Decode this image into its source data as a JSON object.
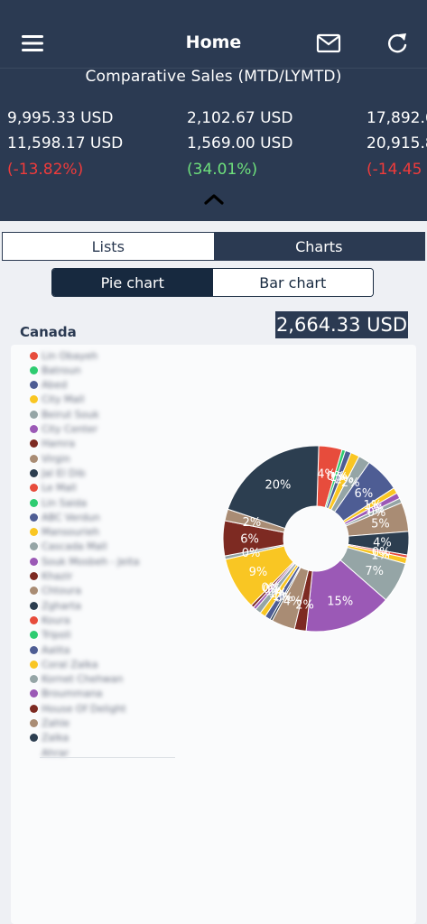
{
  "header": {
    "title": "Home",
    "subtitle": "Comparative Sales (MTD/LYMTD)"
  },
  "metrics": [
    {
      "mtd": "9,995.33 USD",
      "lymtd": "11,598.17 USD",
      "change": "(-13.82%)",
      "trend": "negative"
    },
    {
      "mtd": "2,102.67 USD",
      "lymtd": "1,569.00 USD",
      "change": "(34.01%)",
      "trend": "positive"
    },
    {
      "mtd": "17,892.6",
      "lymtd": "20,915.8",
      "change": "(-14.45",
      "trend": "negative"
    }
  ],
  "tabs": {
    "lists": "Lists",
    "charts": "Charts",
    "active": "lists"
  },
  "chart_toggle": {
    "pie": "Pie chart",
    "bar": "Bar chart",
    "active": "pie"
  },
  "region": "Canada",
  "total": "2,664.33 USD",
  "colors": {
    "header_bg": "#2b3a52",
    "negative": "#ef3b3b",
    "positive": "#6ee07c",
    "toggle_active": "#17293f"
  },
  "legend": [
    {
      "label": "Lin Obayeh",
      "color": "#e74c3c"
    },
    {
      "label": "Batroun",
      "color": "#2ecc71"
    },
    {
      "label": "Abed",
      "color": "#4e5d94"
    },
    {
      "label": "City Mall",
      "color": "#f9c623"
    },
    {
      "label": "Beirut Souk",
      "color": "#95a5a6"
    },
    {
      "label": "City Center",
      "color": "#9b59b6"
    },
    {
      "label": "Hamra",
      "color": "#7d2a22"
    },
    {
      "label": "Virgin",
      "color": "#a98c74"
    },
    {
      "label": "Jal El Dib",
      "color": "#2c3e50"
    },
    {
      "label": "Le Mall",
      "color": "#e74c3c"
    },
    {
      "label": "Lin Saida",
      "color": "#2ecc71"
    },
    {
      "label": "ABC Verdun",
      "color": "#4e5d94"
    },
    {
      "label": "Mansourieh",
      "color": "#f9c623"
    },
    {
      "label": "Cascada Mall",
      "color": "#95a5a6"
    },
    {
      "label": "Souk Mosbeh - Jeita",
      "color": "#9b59b6"
    },
    {
      "label": "Khazir",
      "color": "#7d2a22"
    },
    {
      "label": "Chtoura",
      "color": "#a98c74"
    },
    {
      "label": "Zgharta",
      "color": "#2c3e50"
    },
    {
      "label": "Koura",
      "color": "#e74c3c"
    },
    {
      "label": "Tripoli",
      "color": "#2ecc71"
    },
    {
      "label": "Aalita",
      "color": "#4e5d94"
    },
    {
      "label": "Coral Zalka",
      "color": "#f9c623"
    },
    {
      "label": "Kornet Chehwan",
      "color": "#95a5a6"
    },
    {
      "label": "Broummana",
      "color": "#9b59b6"
    },
    {
      "label": "House Of Delight",
      "color": "#7d2a22"
    },
    {
      "label": "Zahle",
      "color": "#a98c74"
    },
    {
      "label": "Zalka",
      "color": "#2c3e50"
    },
    {
      "label": "Ahrar",
      "color": ""
    }
  ],
  "chart_data": {
    "type": "pie",
    "title": "",
    "labels": [
      "4%",
      "0%",
      "1%",
      "2%",
      "2%",
      "6%",
      "1%",
      "1%",
      "0%",
      "5%",
      "4%",
      "0%",
      "1%",
      "7%",
      "15%",
      "2%",
      "4%",
      "0%",
      "1%",
      "1%",
      "1%",
      "0%",
      "0%",
      "9%",
      "0%",
      "6%",
      "2%",
      "20%"
    ],
    "values": [
      4,
      0.6,
      1.0,
      1.5,
      2,
      6,
      1,
      1,
      0.8,
      5,
      4,
      0.5,
      1,
      7,
      15,
      2,
      4,
      0.4,
      1,
      1,
      1,
      0.5,
      0.5,
      9,
      0.6,
      6,
      2,
      20
    ],
    "colors": [
      "#e74c3c",
      "#2ecc71",
      "#4e5d94",
      "#f9c623",
      "#95a5a6",
      "#4e5d94",
      "#f9c623",
      "#9b59b6",
      "#95a5a6",
      "#a98c74",
      "#2c3e50",
      "#e74c3c",
      "#f9c623",
      "#95a5a6",
      "#9b59b6",
      "#7d2a22",
      "#a98c74",
      "#2c3e50",
      "#4e5d94",
      "#f9c623",
      "#95a5a6",
      "#9b59b6",
      "#7d2a22",
      "#f9c623",
      "#95a5a6",
      "#7d2a22",
      "#a98c74",
      "#2c3e50"
    ]
  }
}
